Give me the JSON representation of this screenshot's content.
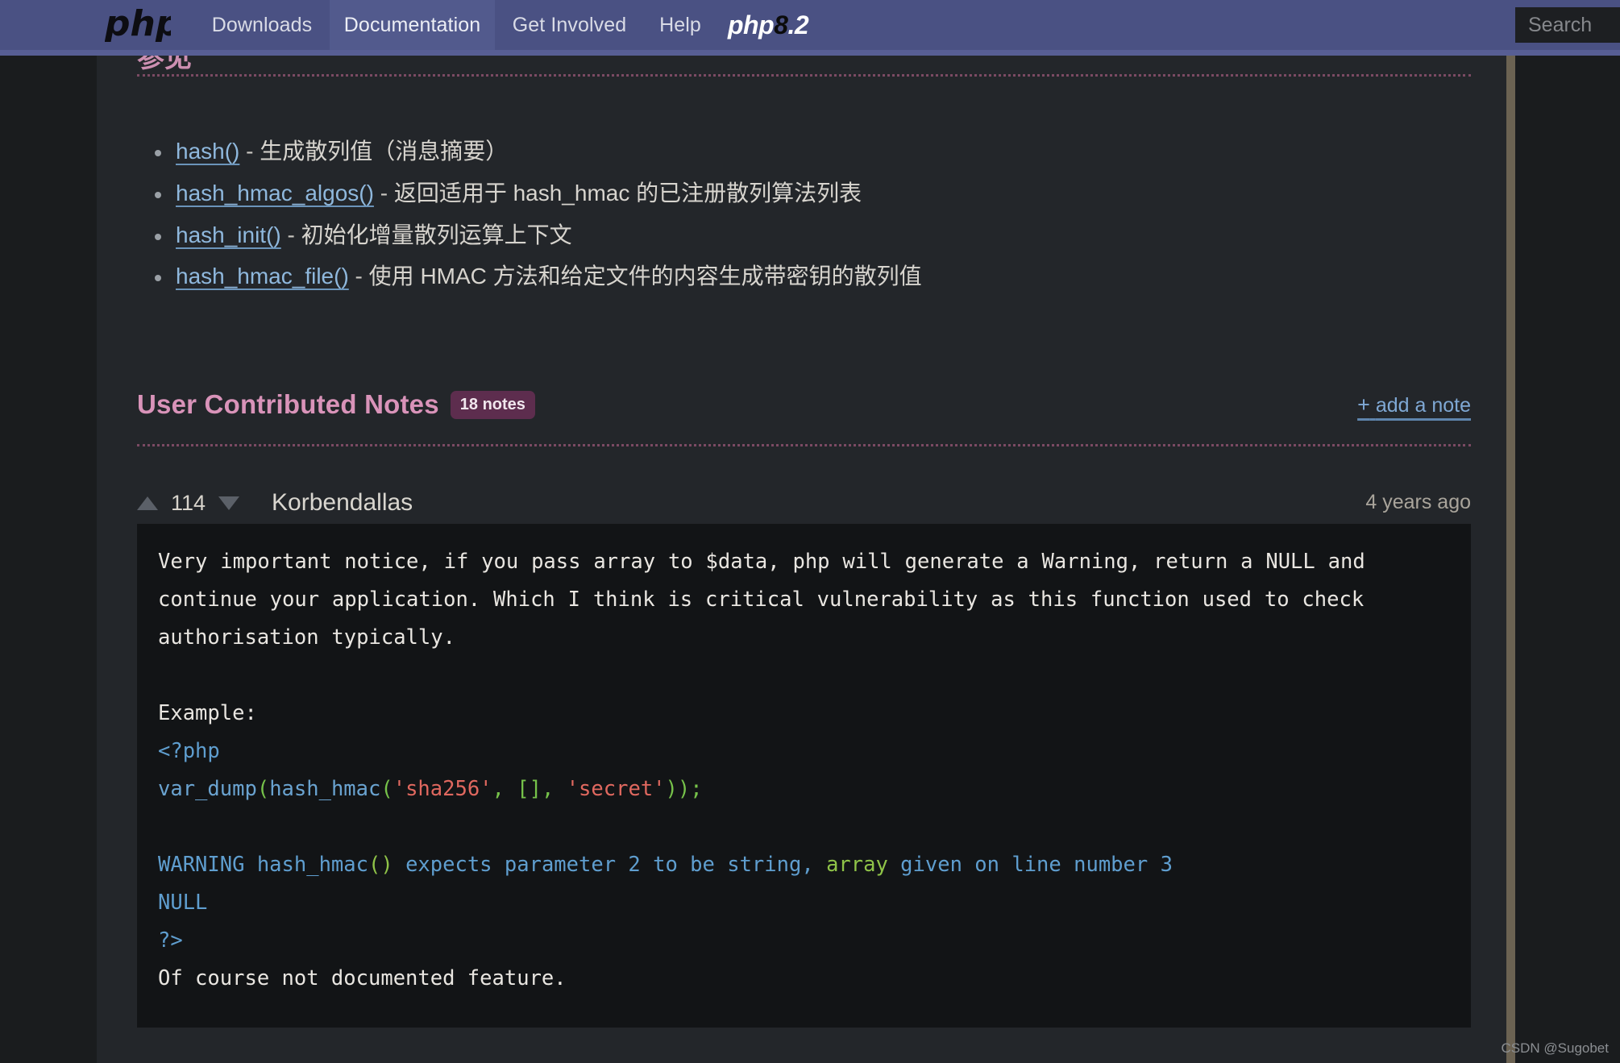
{
  "navbar": {
    "logo_icon": "php-logo",
    "items": [
      {
        "label": "Downloads",
        "active": false
      },
      {
        "label": "Documentation",
        "active": true
      },
      {
        "label": "Get Involved",
        "active": false
      },
      {
        "label": "Help",
        "active": false
      }
    ],
    "version_logo": {
      "prefix": "php",
      "eight": "8",
      "suffix": ".2"
    },
    "search_placeholder": "Search",
    "bg_color": "#4a5183",
    "active_bg_color": "#525a8d"
  },
  "cut_heading": "参见",
  "function_list": [
    {
      "link": "hash()",
      "dash": " - ",
      "desc": "生成散列值（消息摘要）"
    },
    {
      "link": "hash_hmac_algos()",
      "dash": " - ",
      "desc": "返回适用于 hash_hmac 的已注册散列算法列表"
    },
    {
      "link": "hash_init()",
      "dash": " - ",
      "desc": "初始化增量散列运算上下文"
    },
    {
      "link": "hash_hmac_file()",
      "dash": " - ",
      "desc": "使用 HMAC 方法和给定文件的内容生成带密钥的散列值"
    }
  ],
  "notes_section": {
    "title": "User Contributed Notes",
    "badge": "18 notes",
    "add_note_plus": "+",
    "add_note_label": "add a note",
    "title_color": "#d993b9",
    "badge_bg": "#5d2d4e"
  },
  "note": {
    "vote_count": "114",
    "vote_up_icon": "triangle-up-icon",
    "vote_down_icon": "triangle-down-icon",
    "author": "Korbendallas",
    "date": "4 years ago",
    "body_paragraph": "Very important notice, if you pass array to $data, php will generate a Warning, return a NULL and continue your application. Which I think is critical vulnerability as this function used to check authorisation typically.",
    "example_label": "Example:",
    "code_open_tag": "<?php",
    "code_line": {
      "fn1": "var_dump",
      "p1": "(",
      "fn2": "hash_hmac",
      "p2": "(",
      "s1": "'sha256'",
      "sep1": ", ",
      "arr": "[]",
      "sep2": ", ",
      "s2": "'secret'",
      "p3": "))",
      "semi": ";"
    },
    "warning_line": {
      "seg1": "WARNING hash_hmac",
      "seg2": "()",
      "seg3": " expects parameter 2 to be string, ",
      "seg4": "array",
      "seg5": " given on line number 3"
    },
    "null_line": "NULL",
    "code_close_tag": "?>",
    "footer_line": "Of course not documented feature.",
    "code_bg": "#121416"
  },
  "watermark": "CSDN @Sugobet"
}
